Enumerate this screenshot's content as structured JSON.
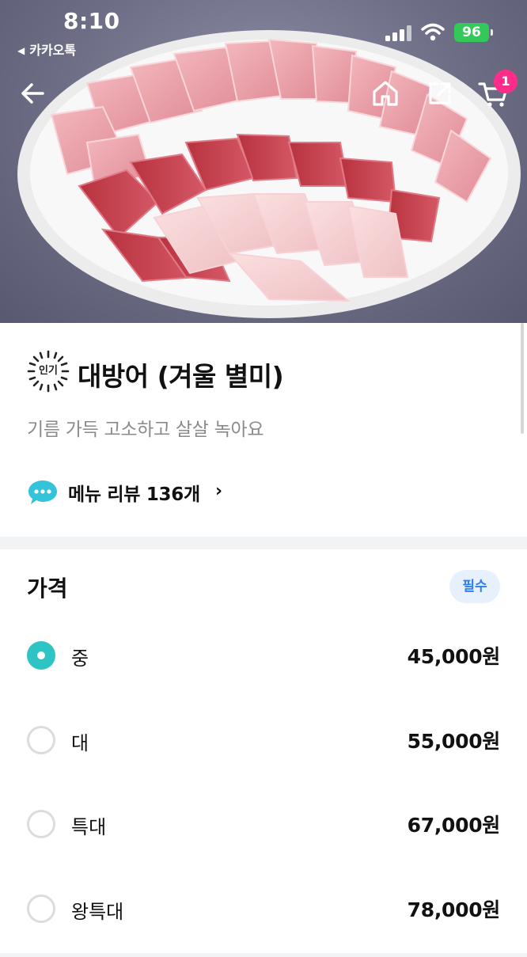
{
  "status_bar": {
    "time": "8:10",
    "back_app_label": "카카오톡",
    "battery_level": "96"
  },
  "nav": {
    "back_icon": "arrow-left-icon",
    "home_icon": "home-icon",
    "share_icon": "share-icon",
    "cart_icon": "cart-icon",
    "cart_count": "1"
  },
  "product": {
    "popular_badge": "인기",
    "title": "대방어 (겨울 별미)",
    "description": "기름 가득 고소하고 살살 녹아요",
    "review_label": "메뉴 리뷰 136개",
    "review_chevron": "›"
  },
  "price_section": {
    "title": "가격",
    "required_badge": "필수",
    "options": [
      {
        "label": "중",
        "price": "45,000원",
        "selected": true
      },
      {
        "label": "대",
        "price": "55,000원",
        "selected": false
      },
      {
        "label": "특대",
        "price": "67,000원",
        "selected": false
      },
      {
        "label": "왕특대",
        "price": "78,000원",
        "selected": false
      }
    ]
  },
  "colors": {
    "accent_teal": "#2ec4c4",
    "badge_pink": "#ff2d8a",
    "required_blue": "#2f7df6"
  }
}
